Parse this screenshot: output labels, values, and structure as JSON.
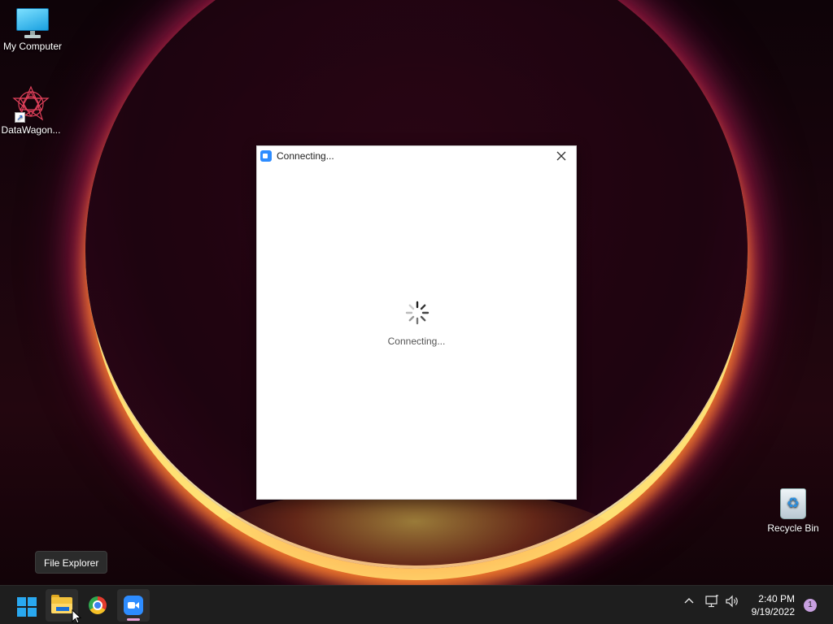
{
  "desktop": {
    "icons": [
      {
        "label": "My Computer",
        "icon": "monitor-icon"
      },
      {
        "label": "DataWagon...",
        "icon": "datawagon-app-icon"
      },
      {
        "label": "Recycle Bin",
        "icon": "recycle-bin-icon"
      }
    ]
  },
  "dialog": {
    "title": "Connecting...",
    "status": "Connecting...",
    "app_icon": "zoom-icon",
    "close_icon": "close-icon",
    "accent_color": "#2d8cff"
  },
  "tooltip": {
    "text": "File Explorer"
  },
  "taskbar": {
    "apps": [
      {
        "name": "Start",
        "icon": "windows-logo-icon"
      },
      {
        "name": "File Explorer",
        "icon": "folder-icon"
      },
      {
        "name": "Google Chrome",
        "icon": "chrome-icon"
      },
      {
        "name": "Zoom",
        "icon": "zoom-icon"
      }
    ],
    "tray": {
      "chevron_icon": "chevron-up-icon",
      "network_icon": "network-icon",
      "volume_icon": "volume-icon",
      "time": "2:40 PM",
      "date": "9/19/2022",
      "notification_count": "1"
    }
  }
}
